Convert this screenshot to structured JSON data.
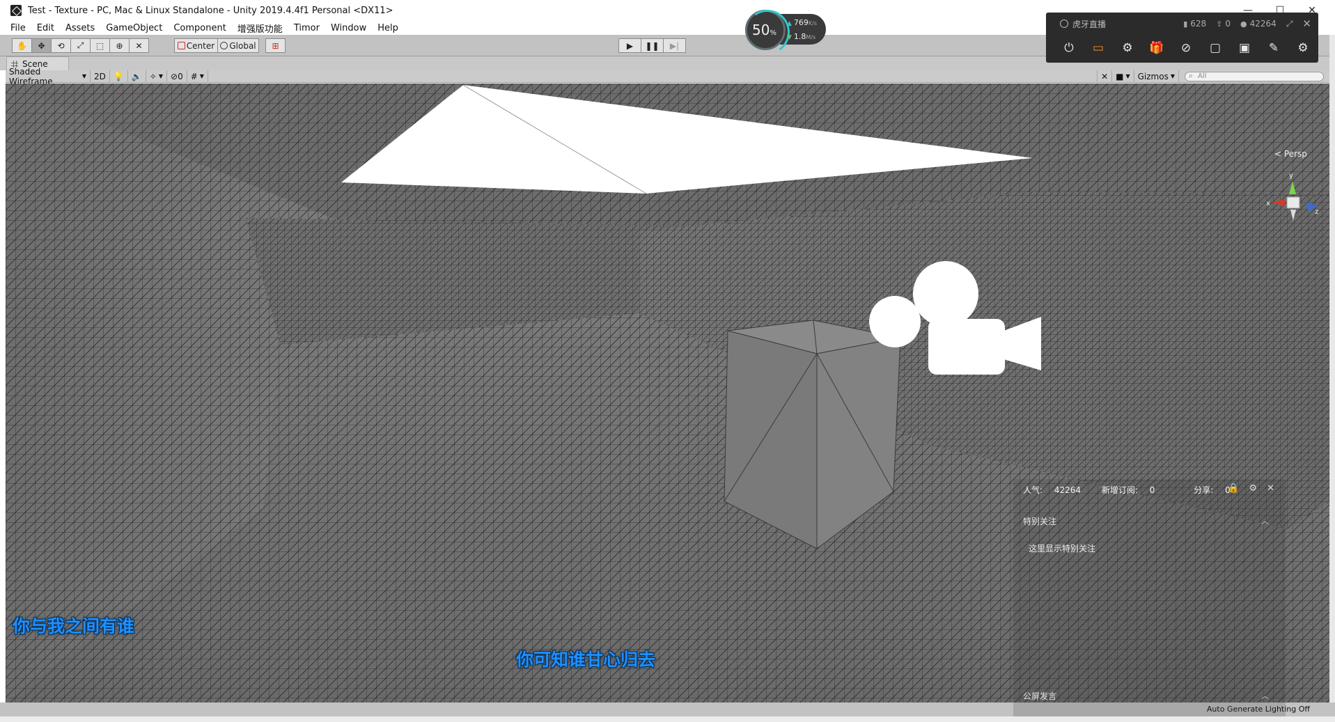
{
  "window": {
    "title": "Test - Texture - PC, Mac & Linux Standalone - Unity 2019.4.4f1 Personal <DX11>",
    "controls": [
      "—",
      "☐",
      "✕"
    ]
  },
  "menu": [
    "File",
    "Edit",
    "Assets",
    "GameObject",
    "Component",
    "增强版功能",
    "Timor",
    "Window",
    "Help"
  ],
  "toolbar": {
    "pivot_label": "Center",
    "space_label": "Global"
  },
  "scene_tab": {
    "label": "Scene"
  },
  "scene_toolbar": {
    "draw_mode": "Shaded Wireframe",
    "mode_2d": "2D",
    "hidden_count": "0",
    "gizmos_label": "Gizmos",
    "search_placeholder": "All"
  },
  "gizmo": {
    "x": "x",
    "y": "y",
    "z": "z",
    "projection": "Persp"
  },
  "speed_widget": {
    "percent": "50",
    "percent_unit": "%",
    "upload": "769",
    "upload_unit": "K/s",
    "download": "1.8",
    "download_unit": "M/s",
    "ring_color": "#35c4c9"
  },
  "huya": {
    "brand": "虎牙直播",
    "stat_bars": "628",
    "stat_share": "0",
    "stat_users": "42264",
    "accent": "#f08c28",
    "icons": [
      "power-icon",
      "chat-icon",
      "screen-settings-icon",
      "gift-icon",
      "mute-icon",
      "camera-icon",
      "record-icon",
      "tools-icon",
      "settings-icon"
    ]
  },
  "stats_panel": {
    "popularity_label": "人气:",
    "popularity": "42264",
    "subs_label": "新增订阅:",
    "subs": "0",
    "share_label": "分享:",
    "share": "0",
    "special_follow_title": "特别关注",
    "special_follow_hint": "这里显示特别关注",
    "public_chat_title": "公屏发言"
  },
  "lyrics": {
    "left": "你与我之间有谁",
    "middle": "你可知谁甘心归去"
  },
  "status": {
    "text": "Auto Generate Lighting Off"
  }
}
